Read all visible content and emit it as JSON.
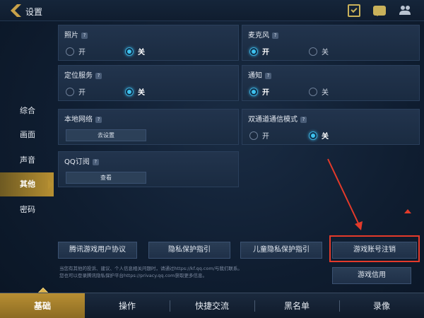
{
  "header": {
    "title": "设置"
  },
  "sidebar": {
    "items": [
      "综合",
      "画面",
      "声音",
      "其他",
      "密码"
    ]
  },
  "cards": {
    "photo": {
      "title": "照片",
      "on": "开",
      "off": "关"
    },
    "mic": {
      "title": "麦克风",
      "on": "开",
      "off": "关"
    },
    "location": {
      "title": "定位服务",
      "on": "开",
      "off": "关"
    },
    "notify": {
      "title": "通知",
      "on": "开",
      "off": "关"
    },
    "localnet": {
      "title": "本地网络",
      "button": "去设置"
    },
    "dualmode": {
      "title": "双通道通信模式",
      "on": "开",
      "off": "关"
    },
    "qq": {
      "title": "QQ订阅",
      "button": "查看"
    }
  },
  "links": {
    "user_agreement": "腾讯游戏用户协议",
    "privacy": "隐私保护指引",
    "child_privacy": "儿童隐私保护指引",
    "cancel_account": "游戏账号注销",
    "credit": "游戏信用"
  },
  "fine_print": {
    "line1": "当您有其他的投诉、建议、个人信息相关问题时，请通过https://kf.qq.com/与我们联系。",
    "line2": "您也可以登录腾讯隐私保护平台https://privacy.qq.com获取更多信息。"
  },
  "tabs": [
    "基础",
    "操作",
    "快捷交流",
    "黑名单",
    "录像"
  ],
  "colors": {
    "accent_gold": "#b79032",
    "radio_on": "#3ec2ee",
    "highlight": "#e43a2a"
  }
}
